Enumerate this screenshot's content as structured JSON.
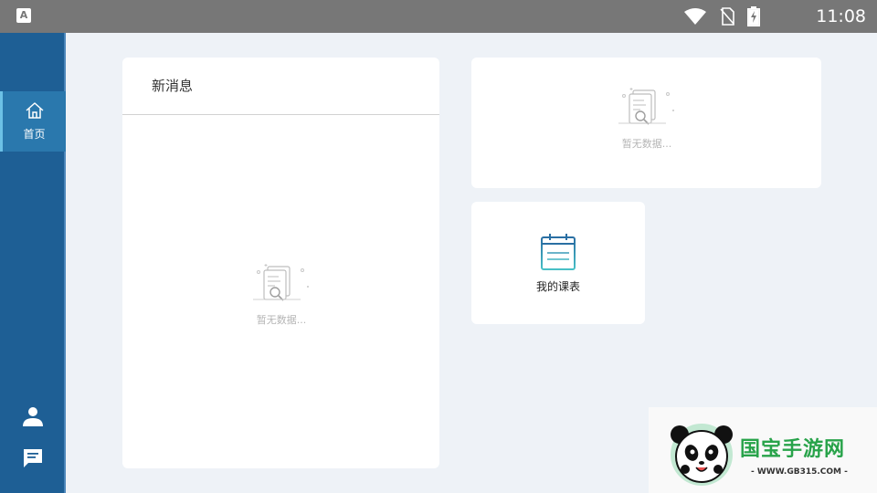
{
  "status_bar": {
    "time": "11:08",
    "icons": [
      "app-a-icon",
      "wifi-icon",
      "no-sim-icon",
      "battery-charging-icon"
    ]
  },
  "sidebar": {
    "items": [
      {
        "label": "首页",
        "icon": "home-icon",
        "active": true
      },
      {
        "label": "",
        "icon": "user-icon"
      },
      {
        "label": "",
        "icon": "message-icon"
      }
    ]
  },
  "messages_card": {
    "title": "新消息",
    "empty_text": "暂无数据..."
  },
  "top_right_card": {
    "empty_text": "暂无数据..."
  },
  "schedule_card": {
    "label": "我的课表",
    "icon": "calendar-icon"
  },
  "watermark": {
    "brand": "国宝手游网",
    "url": "- WWW.GB315.COM -"
  },
  "colors": {
    "sidebar": "#1e5f95",
    "sidebar_active": "#2a78ad",
    "background": "#eef2f7",
    "status_bar": "#777777",
    "accent": "#3ab0c4"
  }
}
